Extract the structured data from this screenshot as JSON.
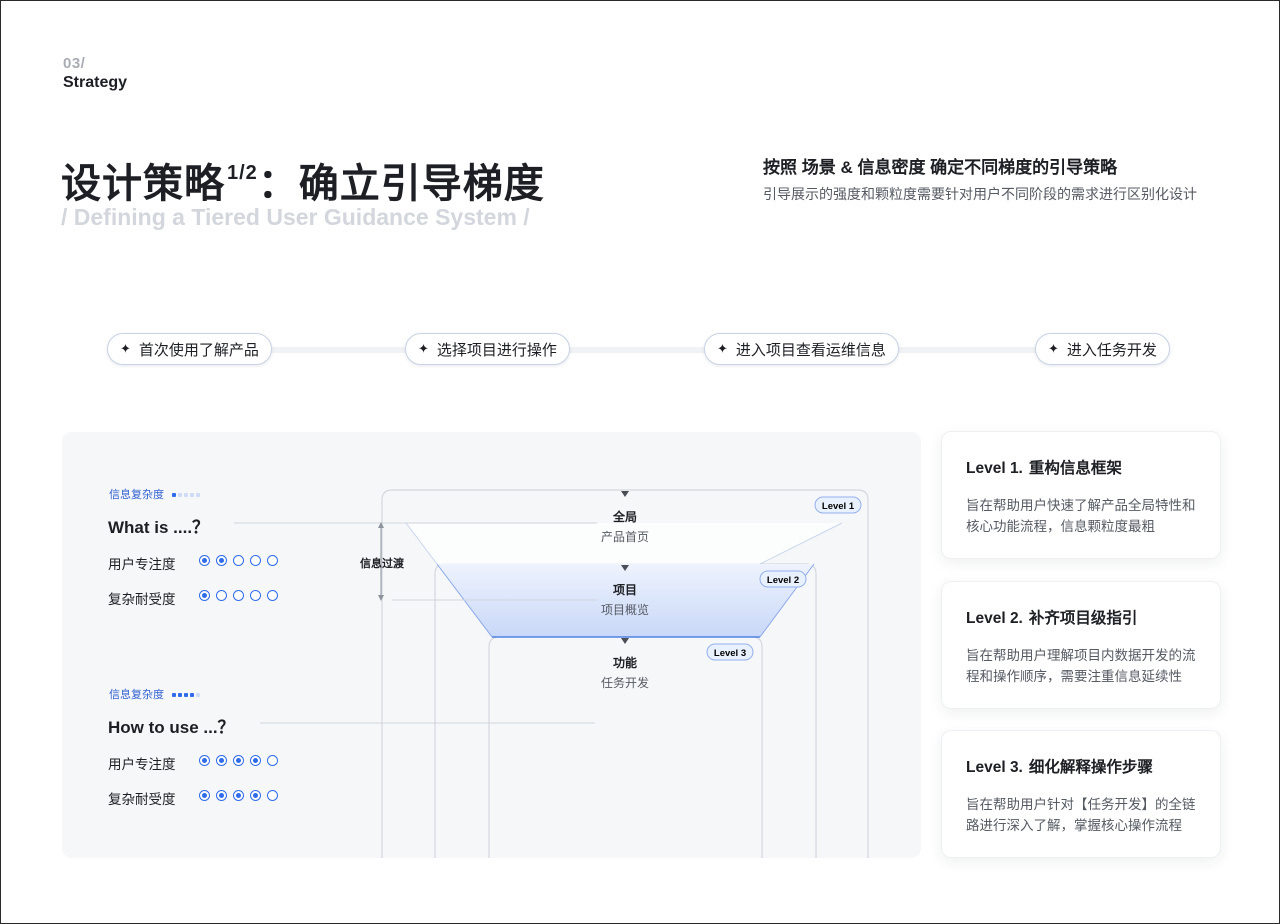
{
  "header": {
    "section_number": "03/",
    "section_name": "Strategy",
    "title_main": "设计策略",
    "title_sup": "1/2",
    "title_rest": "：确立引导梯度",
    "subtitle_en": "/ Defining a Tiered User Guidance System /",
    "right_title": "按照 场景 & 信息密度 确定不同梯度的引导策略",
    "right_desc": "引导展示的强度和颗粒度需要针对用户不同阶段的需求进行区别化设计"
  },
  "steps": [
    {
      "label": "首次使用了解产品"
    },
    {
      "label": "选择项目进行操作"
    },
    {
      "label": "进入项目查看运维信息"
    },
    {
      "label": "进入任务开发"
    }
  ],
  "left_panel": {
    "block1": {
      "complexity_label": "信息复杂度",
      "complexity_level": 1,
      "complexity_max": 5,
      "question": "What is ....？",
      "metrics": [
        {
          "label": "用户专注度",
          "value": 2,
          "max": 5
        },
        {
          "label": "复杂耐受度",
          "value": 1,
          "max": 5
        }
      ]
    },
    "transition_label": "信息过渡",
    "block2": {
      "complexity_label": "信息复杂度",
      "complexity_level": 4,
      "complexity_max": 5,
      "question": "How to use ...？",
      "metrics": [
        {
          "label": "用户专注度",
          "value": 4,
          "max": 5
        },
        {
          "label": "复杂耐受度",
          "value": 4,
          "max": 5
        }
      ]
    }
  },
  "diagram": {
    "levels": [
      {
        "badge": "Level 1",
        "title": "全局",
        "subtitle": "产品首页"
      },
      {
        "badge": "Level 2",
        "title": "项目",
        "subtitle": "项目概览"
      },
      {
        "badge": "Level 3",
        "title": "功能",
        "subtitle": "任务开发"
      }
    ]
  },
  "cards": [
    {
      "level": "Level 1.",
      "title": "重构信息框架",
      "desc": "旨在帮助用户快速了解产品全局特性和核心功能流程，信息颗粒度最粗"
    },
    {
      "level": "Level 2.",
      "title": "补齐项目级指引",
      "desc": "旨在帮助用户理解项目内数据开发的流程和操作顺序，需要注重信息延续性"
    },
    {
      "level": "Level 3.",
      "title": "细化解释操作步骤",
      "desc": "旨在帮助用户针对【任务开发】的全链路进行深入了解，掌握核心操作流程"
    }
  ]
}
